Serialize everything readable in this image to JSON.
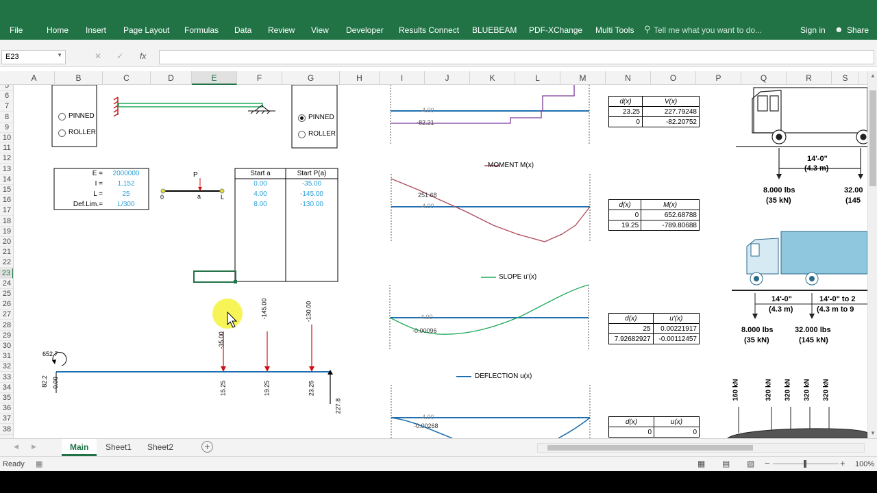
{
  "ribbon": {
    "tabs": [
      "File",
      "Home",
      "Insert",
      "Page Layout",
      "Formulas",
      "Data",
      "Review",
      "View",
      "Developer",
      "Results Connect",
      "BLUEBEAM",
      "PDF-XChange",
      "Multi Tools"
    ],
    "tell_me": "Tell me what you want to do...",
    "sign_in": "Sign in",
    "share": "Share"
  },
  "formula_bar": {
    "name_box": "E23",
    "fx": "fx",
    "value": ""
  },
  "columns": [
    "A",
    "B",
    "C",
    "D",
    "E",
    "F",
    "G",
    "H",
    "I",
    "J",
    "K",
    "L",
    "M",
    "N",
    "O",
    "P",
    "Q",
    "R",
    "S"
  ],
  "selected_column": "E",
  "rows": [
    "5",
    "6",
    "7",
    "8",
    "9",
    "10",
    "11",
    "12",
    "13",
    "14",
    "15",
    "16",
    "17",
    "18",
    "19",
    "20",
    "21",
    "22",
    "23",
    "24",
    "25",
    "26",
    "27",
    "28",
    "29",
    "30",
    "31",
    "32",
    "33",
    "34",
    "35",
    "36",
    "37",
    "38"
  ],
  "selected_row": "23",
  "support_left": {
    "opt1": "PINNED",
    "opt2": "ROLLER",
    "selected": "PINNED"
  },
  "support_right": {
    "opt1": "PINNED",
    "opt2": "ROLLER",
    "selected": "PINNED"
  },
  "props": {
    "labels": [
      "E =",
      "I =",
      "L =",
      "Def.Lim.="
    ],
    "values": [
      "2000000",
      "1.152",
      "25",
      "L/300"
    ]
  },
  "beam_sketch": {
    "load": "P",
    "left": "0",
    "mid": "a",
    "right": "L"
  },
  "loads_table": {
    "headers": [
      "Start a",
      "Start P(a)"
    ],
    "rows": [
      [
        "0.00",
        "-35.00"
      ],
      [
        "4.00",
        "-145.00"
      ],
      [
        "8.00",
        "-130.00"
      ]
    ]
  },
  "beam_diagram": {
    "moment_label": "652.7",
    "left_reaction": "82.2",
    "left_zero": "0.00",
    "load_values": [
      "-35.00",
      "-145.00",
      "-130.00"
    ],
    "load_positions": [
      "15.25",
      "19.25",
      "23.25"
    ],
    "right_reaction": "227.8"
  },
  "shear": {
    "label_top": "4.00",
    "label_min": "-82.21"
  },
  "moment": {
    "legend": "MOMENT M(x)",
    "label_max": "251.68",
    "label_zero": "4.00"
  },
  "slope": {
    "legend": "SLOPE u'(x)",
    "label_zero": "4.00",
    "label_min": "-0.00096"
  },
  "deflection": {
    "legend": "DEFLECTION u(x)",
    "label_zero": "4.00",
    "label_min": "-0.00268"
  },
  "tables": {
    "shear": {
      "headers": [
        "d(x)",
        "V(x)"
      ],
      "rows": [
        [
          "23.25",
          "227.79248"
        ],
        [
          "0",
          "-82.20752"
        ]
      ]
    },
    "moment": {
      "headers": [
        "d(x)",
        "M(x)"
      ],
      "rows": [
        [
          "0",
          "652.68788"
        ],
        [
          "19.25",
          "-789.80688"
        ]
      ]
    },
    "slope": {
      "headers": [
        "d(x)",
        "u'(x)"
      ],
      "rows": [
        [
          "25",
          "0.00221917"
        ],
        [
          "7.92682927",
          "-0.00112457"
        ]
      ]
    },
    "deflection": {
      "headers": [
        "d(x)",
        "u(x)"
      ],
      "rows": [
        [
          "0",
          "0"
        ]
      ]
    }
  },
  "trucks": {
    "t1_spacing": "14'-0\"",
    "t1_spacing_m": "(4.3 m)",
    "t1_axle1": "8.000 lbs",
    "t1_axle1_kn": "(35 kN)",
    "t1_axle2": "32.00",
    "t1_axle2_kn": "(145",
    "t2_spacing1": "14'-0\"",
    "t2_spacing1_m": "(4.3 m)",
    "t2_spacing2": "14'-0\" to 2",
    "t2_spacing2_m": "(4.3 m to 9",
    "t2_axle1": "8.000 lbs",
    "t2_axle1_kn": "(35 kN)",
    "t2_axle2": "32.000 lbs",
    "t2_axle2_kn": "(145 kN)",
    "kn_loads": [
      "160 kN",
      "320 kN",
      "320 kN",
      "320 kN",
      "320 kN"
    ]
  },
  "sheet_tabs": [
    "Main",
    "Sheet1",
    "Sheet2"
  ],
  "active_sheet": "Main",
  "status": {
    "ready": "Ready",
    "zoom": "100%"
  },
  "colors": {
    "excel_green": "#217346",
    "beam_blue": "#1f6fb0",
    "moment_red": "#b04a5a",
    "slope_green": "#1faa5a",
    "shear_purple": "#7a3a9a",
    "load_red": "#d01010"
  }
}
